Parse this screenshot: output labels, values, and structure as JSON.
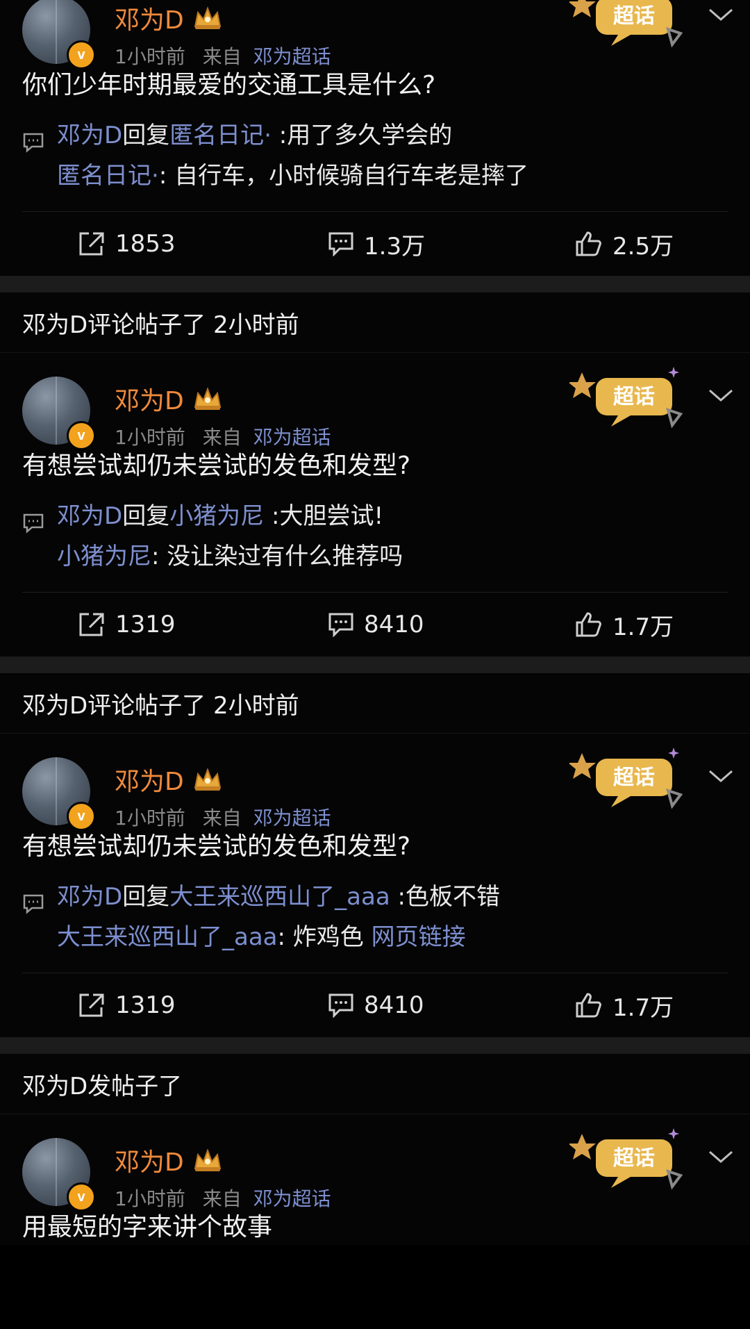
{
  "common": {
    "author": "邓为D",
    "time": "1小时前",
    "from_label": "来自",
    "source": "邓为超话",
    "verified_mark": "v",
    "chaohua_label": "超话"
  },
  "cards": [
    {
      "header": null,
      "text": "你们少年时期最爱的交通工具是什么?",
      "reply1": {
        "author": "邓为D",
        "verb": "回复",
        "target": "匿名日记",
        "target_suffix": "·",
        "sep": " :",
        "content": "用了多久学会的"
      },
      "reply2": {
        "author": "匿名日记",
        "author_suffix": "·",
        "sep": ": ",
        "content": "自行车，小时候骑自行车老是摔了",
        "link": ""
      },
      "repost": "1853",
      "comments": "1.3万",
      "likes": "2.5万"
    },
    {
      "header": "邓为D评论帖子了 2小时前",
      "text": "有想尝试却仍未尝试的发色和发型?",
      "reply1": {
        "author": "邓为D",
        "verb": "回复",
        "target": "小猪为尼",
        "target_suffix": "",
        "sep": " :",
        "content": "大胆尝试!"
      },
      "reply2": {
        "author": "小猪为尼",
        "author_suffix": "",
        "sep": ": ",
        "content": "没让染过有什么推荐吗",
        "link": ""
      },
      "repost": "1319",
      "comments": "8410",
      "likes": "1.7万"
    },
    {
      "header": "邓为D评论帖子了 2小时前",
      "text": "有想尝试却仍未尝试的发色和发型?",
      "reply1": {
        "author": "邓为D",
        "verb": "回复",
        "target": "大王来巡西山了_aaa",
        "target_suffix": "",
        "sep": " :",
        "content": "色板不错"
      },
      "reply2": {
        "author": "大王来巡西山了_aaa",
        "author_suffix": "",
        "sep": ": ",
        "content": "炸鸡色 ",
        "link": "网页链接"
      },
      "repost": "1319",
      "comments": "8410",
      "likes": "1.7万"
    },
    {
      "header": "邓为D发帖子了",
      "text": "用最短的字来讲个故事"
    }
  ],
  "colors": {
    "background": "#000000",
    "card": "#050505",
    "author": "#ef8a3c",
    "link": "#7d8fcf",
    "meta": "#8a8a8a",
    "badge": "#f2a21c",
    "chaohua": "#e8b74e"
  },
  "icons": [
    "chevron-down-icon",
    "repost-icon",
    "comment-icon",
    "like-icon",
    "reply-comment-icon",
    "chaohua-icon",
    "crown-icon"
  ]
}
